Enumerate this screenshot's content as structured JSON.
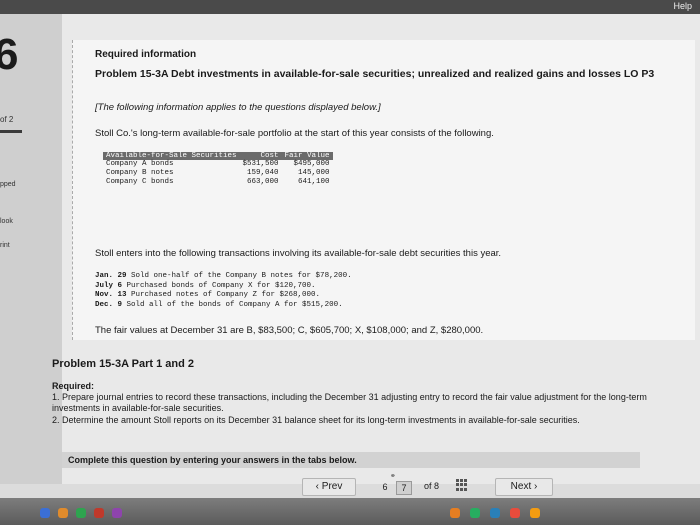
{
  "header": {
    "help_label": "Help"
  },
  "left_nav": {
    "question_number": "6",
    "part_count": "of 2",
    "items": [
      "pped",
      "look",
      "rint"
    ]
  },
  "problem": {
    "required_info": "Required information",
    "title": "Problem 15-3A Debt investments in available-for-sale securities; unrealized and realized gains and losses LO P3",
    "intro": "[The following information applies to the questions displayed below.]",
    "portfolio_intro": "Stoll Co.'s long-term available-for-sale portfolio at the start of this year consists of the following.",
    "table": {
      "headers": [
        "Available-for-Sale Securities",
        "Cost",
        "Fair Value"
      ],
      "rows": [
        [
          "Company A bonds",
          "$531,500",
          "$495,000"
        ],
        [
          "Company B notes",
          "159,040",
          "145,000"
        ],
        [
          "Company C bonds",
          "663,000",
          "641,100"
        ]
      ]
    },
    "transactions_intro": "Stoll enters into the following transactions involving its available-for-sale debt securities this year.",
    "transactions": [
      {
        "date": "Jan. 29",
        "text": "Sold one-half of the Company B notes for $78,200."
      },
      {
        "date": "July  6",
        "text": "Purchased bonds of Company X for $120,700."
      },
      {
        "date": "Nov. 13",
        "text": "Purchased notes of Company Z for $268,000."
      },
      {
        "date": "Dec.  9",
        "text": "Sold all of the bonds of Company A for $515,200."
      }
    ],
    "fair_values": "The fair values at December 31 are B, $83,500; C, $605,700; X, $108,000; and Z, $280,000."
  },
  "part": {
    "title": "Problem 15-3A Part 1 and 2",
    "required_label": "Required:",
    "req1": "1. Prepare journal entries to record these transactions, including the December 31 adjusting entry to record the fair value adjustment for the long-term investments in available-for-sale securities.",
    "req2": "2. Determine the amount Stoll reports on its December 31 balance sheet for its long-term investments in available-for-sale securities.",
    "complete_text": "Complete this question by entering your answers in the tabs below."
  },
  "pagination": {
    "prev_label": "Prev",
    "pages": [
      "6",
      "7"
    ],
    "current_page": "7",
    "of_total": "of 8",
    "next_label": "Next"
  },
  "colors": {
    "accent": "#c0392b",
    "table_header": "#6b6b6b"
  }
}
